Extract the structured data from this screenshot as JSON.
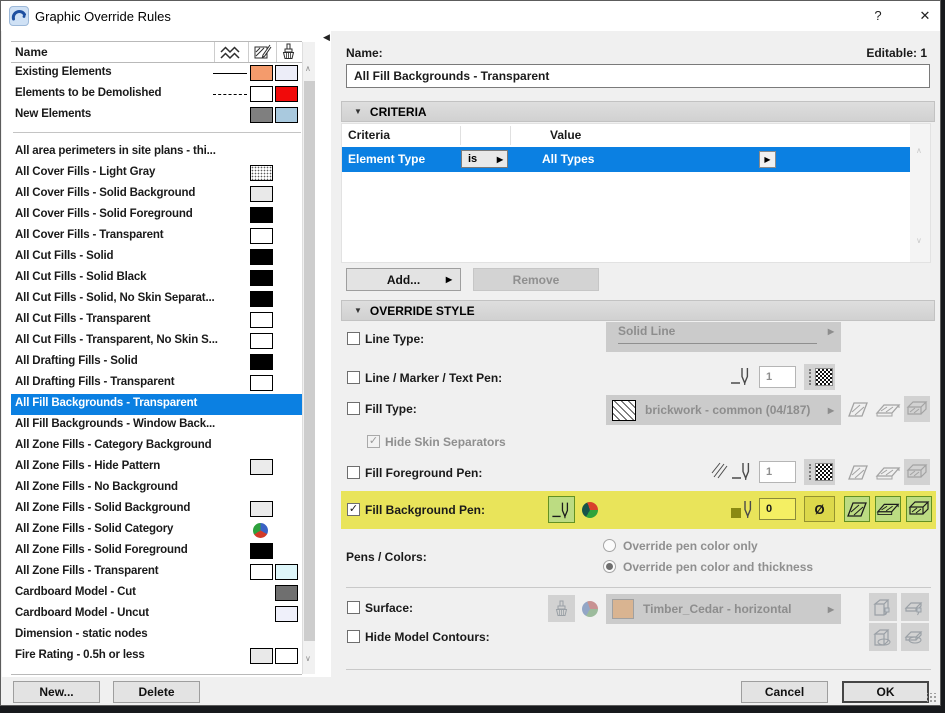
{
  "window": {
    "title": "Graphic Override Rules",
    "help_glyph": "?",
    "close_glyph": "✕"
  },
  "glyphs": {
    "dd": "▶",
    "collapse": "◀",
    "section": "▼",
    "up": "∧",
    "down": "∨",
    "check": "✓"
  },
  "colors": {
    "selection_blue": "#0b80e2",
    "highlight_yellow": "#e9e45a",
    "highlight_green": "#bcdc82",
    "highlight_green_border": "#639122",
    "pen_input_yellow": "#f4ef63",
    "null_pen_button": "#dcd84b",
    "olive_pen_square": "#8a8a12"
  },
  "left_panel": {
    "columns": {
      "name": "Name",
      "icons": [
        "line-type-icon",
        "fill-pen-icon",
        "surface-brush-icon"
      ]
    },
    "top_rules": [
      {
        "label": "Existing Elements",
        "line": "solid",
        "fill": "#f49b6c",
        "surface": "#ecedf8"
      },
      {
        "label": "Elements to be Demolished",
        "line": "dashed",
        "fill": "#ffffff",
        "surface": "#f10a0a"
      },
      {
        "label": "New Elements",
        "line": "none",
        "fill": "#7f7f7f",
        "surface": "#a9c9de"
      }
    ],
    "rules": [
      {
        "label": "All area perimeters in site plans - thi..."
      },
      {
        "label": "All Cover Fills - Light Gray",
        "fill": "stipple"
      },
      {
        "label": "All Cover Fills - Solid Background",
        "fill": "#e9e9e9"
      },
      {
        "label": "All Cover Fills - Solid Foreground",
        "fill": "#000000"
      },
      {
        "label": "All Cover Fills - Transparent",
        "fill": "#ffffff"
      },
      {
        "label": "All Cut Fills - Solid",
        "fill": "#000000"
      },
      {
        "label": "All Cut Fills - Solid Black",
        "fill": "#000000"
      },
      {
        "label": "All Cut Fills - Solid, No Skin Separat...",
        "fill": "#000000"
      },
      {
        "label": "All Cut Fills - Transparent",
        "fill": "#ffffff"
      },
      {
        "label": "All Cut Fills - Transparent, No Skin S...",
        "fill": "#ffffff"
      },
      {
        "label": "All Drafting Fills - Solid",
        "fill": "#000000"
      },
      {
        "label": "All Drafting Fills - Transparent",
        "fill": "#ffffff"
      },
      {
        "label": "All Fill Backgrounds - Transparent",
        "selected": true
      },
      {
        "label": "All Fill Backgrounds - Window Back..."
      },
      {
        "label": "All Zone Fills - Category Background"
      },
      {
        "label": "All Zone Fills - Hide Pattern",
        "fill": "#ebebeb"
      },
      {
        "label": "All Zone Fills - No Background"
      },
      {
        "label": "All Zone Fills - Solid Background",
        "fill": "#ebebeb"
      },
      {
        "label": "All Zone Fills - Solid Category",
        "fill": "pie"
      },
      {
        "label": "All Zone Fills - Solid Foreground",
        "fill": "#000000"
      },
      {
        "label": "All Zone Fills - Transparent",
        "fill": "#ffffff",
        "surface": "#def6fa"
      },
      {
        "label": "Cardboard Model - Cut",
        "surface": "#6f6f6f"
      },
      {
        "label": "Cardboard Model - Uncut",
        "surface": "#eff0fa"
      },
      {
        "label": "Dimension - static nodes"
      },
      {
        "label": "Fire Rating - 0.5h or less",
        "fill": "#e9e9e9",
        "surface": "#ffffff"
      }
    ],
    "new_button": "New...",
    "delete_button": "Delete"
  },
  "right_panel": {
    "name_label": "Name:",
    "editable_label": "Editable: 1",
    "name_value": "All Fill Backgrounds - Transparent",
    "criteria": {
      "header": "CRITERIA",
      "col_criteria": "Criteria",
      "col_value": "Value",
      "row": {
        "criteria": "Element Type",
        "operator": "is",
        "value": "All Types"
      },
      "add_button": "Add...",
      "remove_button": "Remove"
    },
    "override": {
      "header": "OVERRIDE STYLE",
      "line_type": {
        "label": "Line Type:",
        "checked": false,
        "value": "Solid Line"
      },
      "line_marker_text_pen": {
        "label": "Line / Marker / Text Pen:",
        "checked": false,
        "pen_number": "1"
      },
      "fill_type": {
        "label": "Fill Type:",
        "checked": false,
        "value": "brickwork - common (04/187)"
      },
      "hide_skin_separators": {
        "label": "Hide Skin Separators",
        "checked": true,
        "disabled": true
      },
      "fill_foreground_pen": {
        "label": "Fill Foreground Pen:",
        "checked": false,
        "pen_number": "1"
      },
      "fill_background_pen": {
        "label": "Fill Background Pen:",
        "checked": true,
        "pen_number": "0",
        "null_pen_glyph": "Ø"
      },
      "pens_colors": {
        "label": "Pens / Colors:",
        "option_color_only": "Override pen color only",
        "option_color_thickness": "Override pen color and thickness",
        "selected": "Override pen color and thickness"
      },
      "surface": {
        "label": "Surface:",
        "checked": false,
        "value": "Timber_Cedar - horizontal",
        "swatch": "#d9b491"
      },
      "hide_model_contours": {
        "label": "Hide Model Contours:",
        "checked": false
      }
    },
    "cancel_button": "Cancel",
    "ok_button": "OK"
  }
}
